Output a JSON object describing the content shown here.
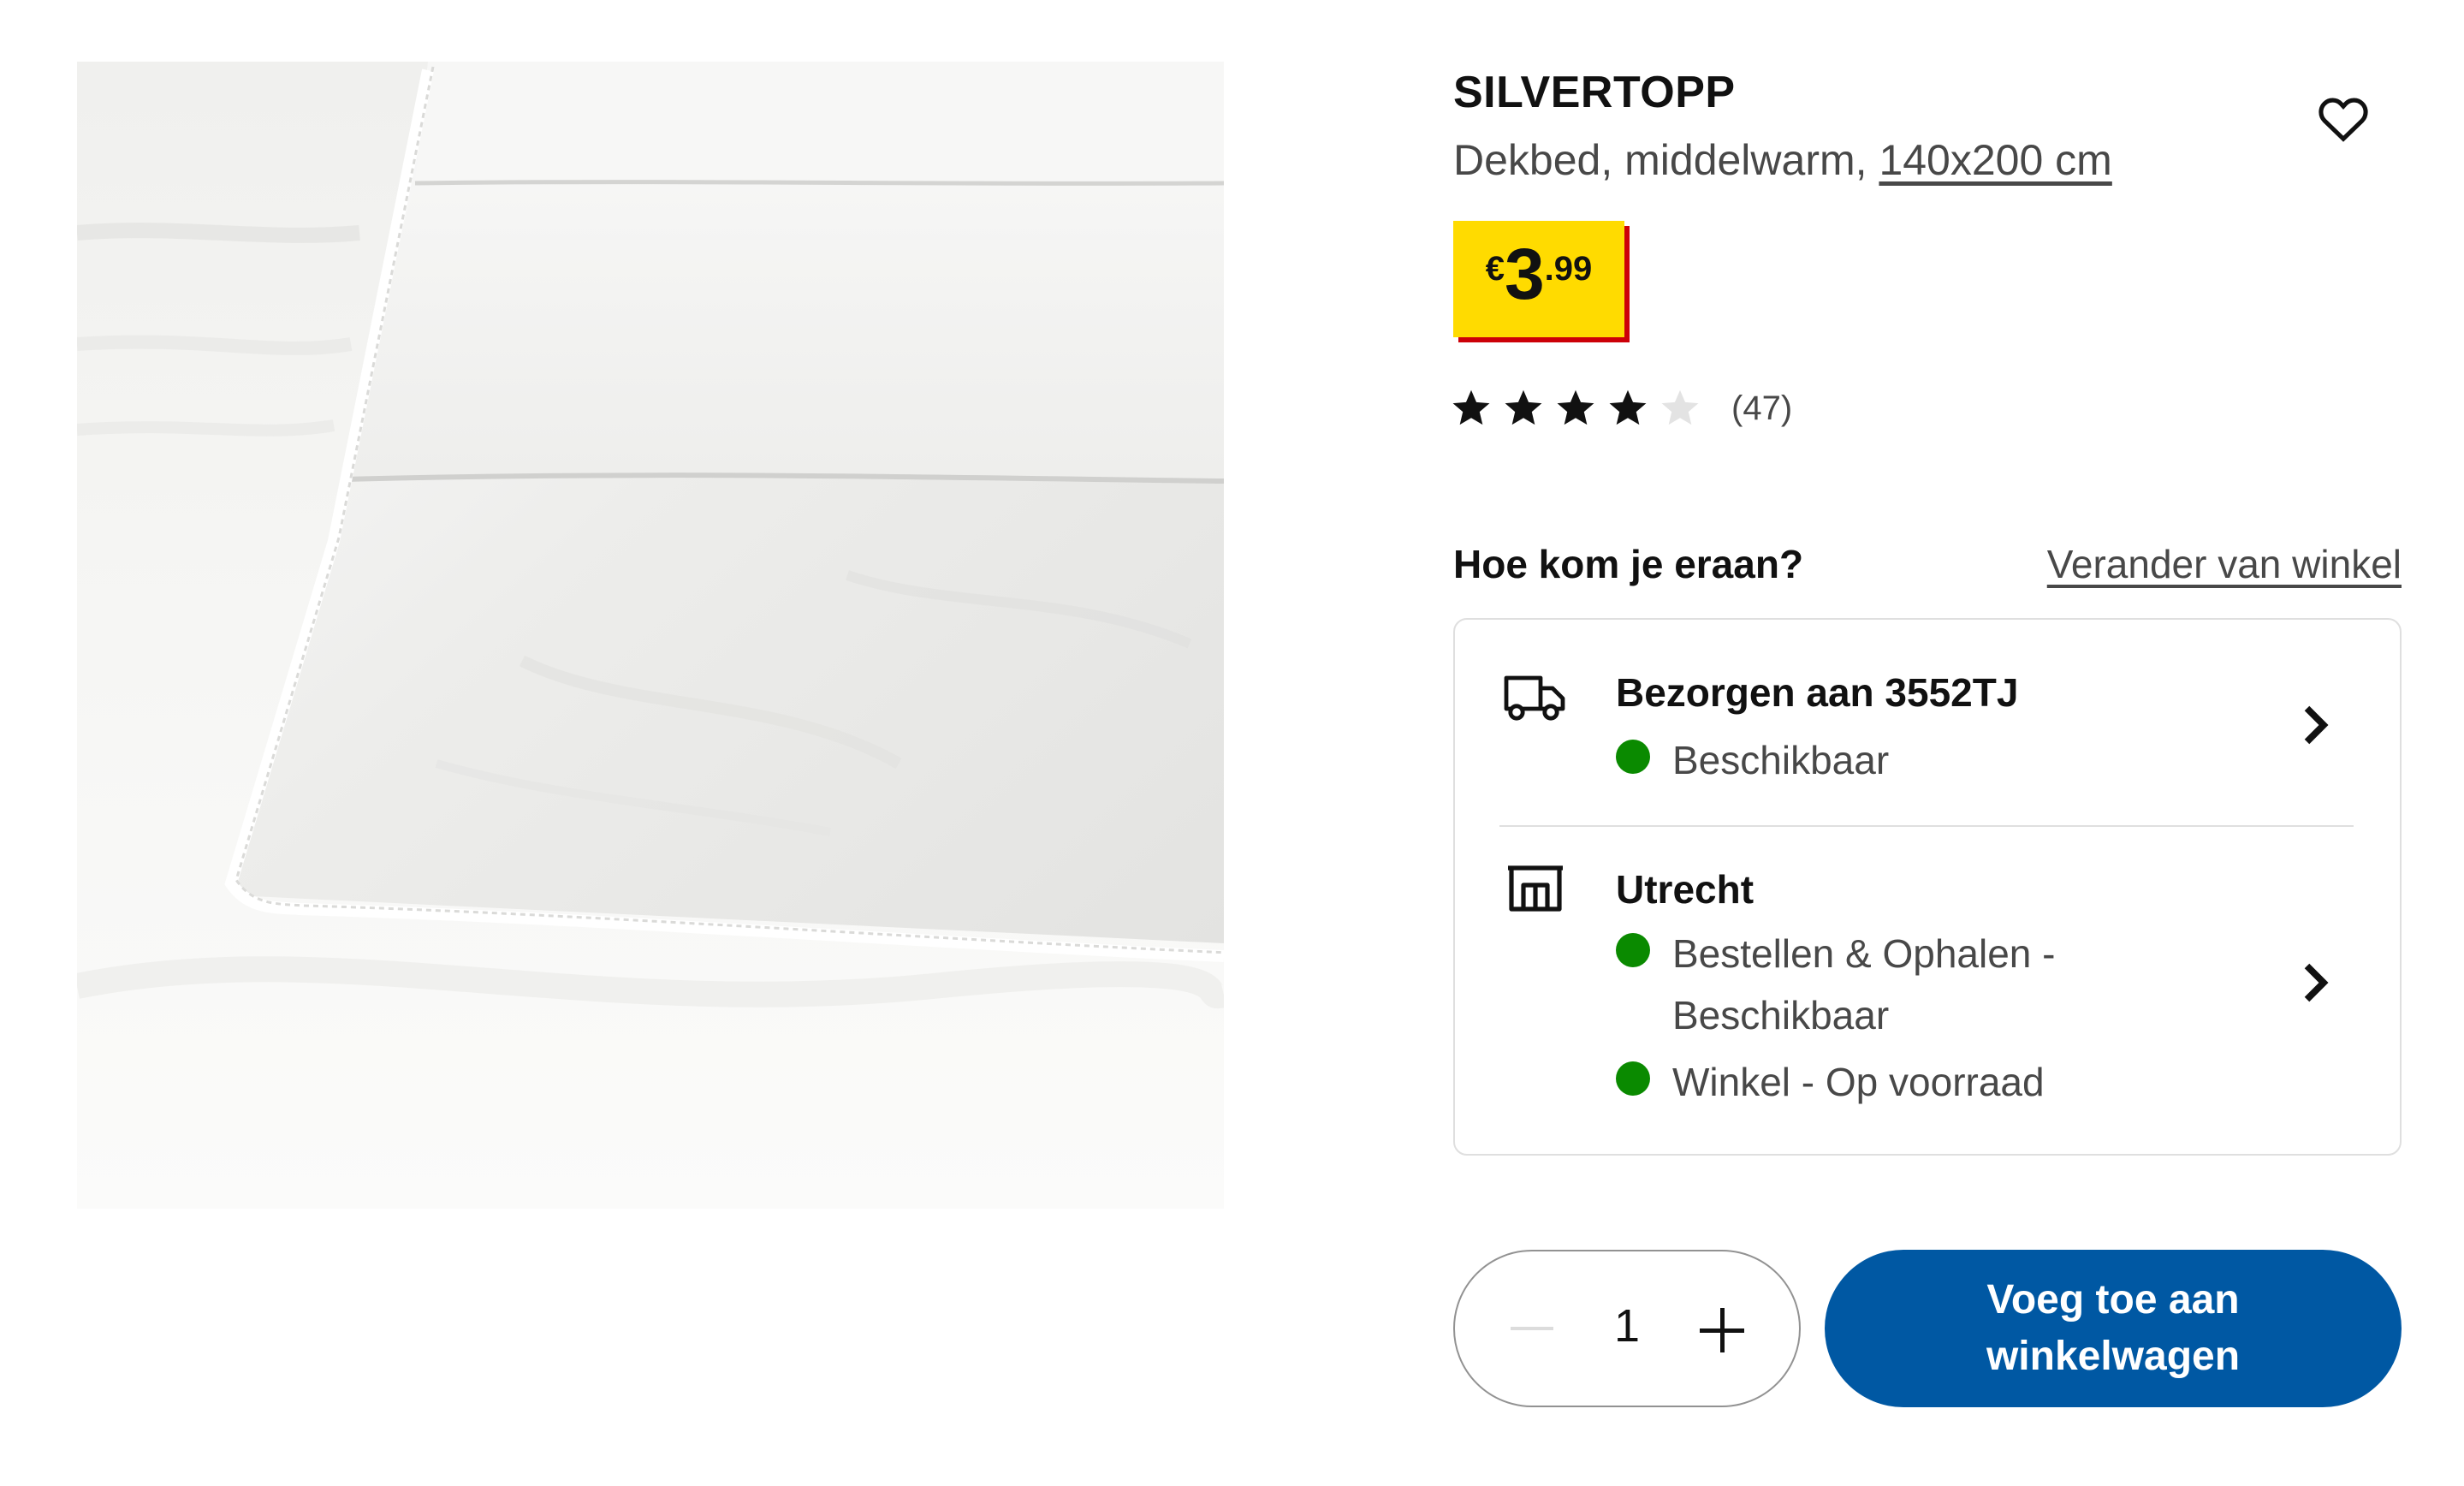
{
  "product": {
    "name": "SILVERTOPP",
    "description": "Dekbed, middelwarm,",
    "size": "140x200 cm",
    "price": {
      "currency": "€",
      "integer": "3",
      "decimal": ".99"
    },
    "rating": {
      "value": 4,
      "max": 5,
      "count_label": "(47)"
    },
    "image_icon": "duvet-photo"
  },
  "colors": {
    "price_tag": "#ffdb00",
    "price_shadow": "#cc0008",
    "primary": "#0058a3",
    "available": "#0a8a00"
  },
  "icons": {
    "favorite": "heart-icon",
    "delivery": "truck-icon",
    "store": "store-icon",
    "chevron": "chevron-right-icon"
  },
  "delivery": {
    "heading": "Hoe kom je eraan?",
    "change_store": "Verander van winkel",
    "options": [
      {
        "title": "Bezorgen aan 3552TJ",
        "statuses": [
          "Beschikbaar"
        ]
      },
      {
        "title": "Utrecht",
        "statuses": [
          "Bestellen & Ophalen - Beschikbaar",
          "Winkel - Op voorraad"
        ]
      }
    ]
  },
  "quantity": {
    "value": "1"
  },
  "cart": {
    "button_label": "Voeg toe aan winkelwagen"
  }
}
